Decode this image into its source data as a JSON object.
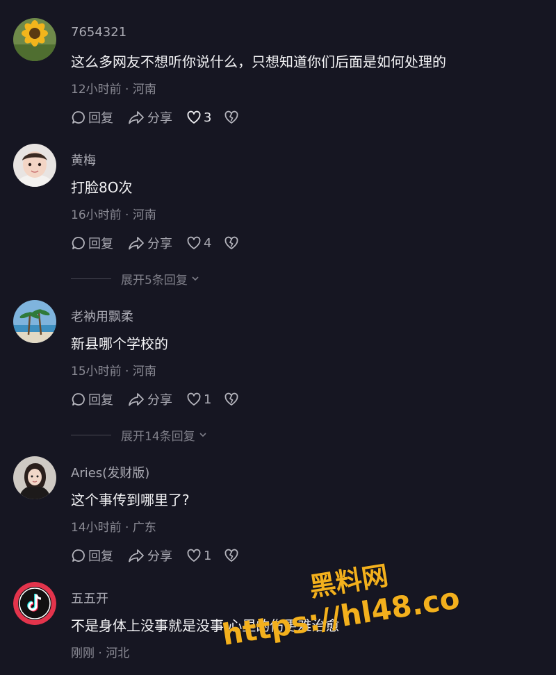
{
  "actions": {
    "reply": "回复",
    "share": "分享"
  },
  "comments": [
    {
      "username": "7654321",
      "text": "这么多网友不想听你说什么，只想知道你们后面是如何处理的",
      "meta": "12小时前 · 河南",
      "likes": "3",
      "avatar": "sunflower"
    },
    {
      "username": "黄梅",
      "text": "打脸8O次",
      "meta": "16小时前 · 河南",
      "likes": "4",
      "avatar": "baby",
      "expand": "展开5条回复"
    },
    {
      "username": "老衲用飘柔",
      "text": "新县哪个学校的",
      "meta": "15小时前 · 河南",
      "likes": "1",
      "avatar": "palm-beach",
      "expand": "展开14条回复"
    },
    {
      "username": "Aries(发财版)",
      "text": "这个事传到哪里了?",
      "meta": "14小时前 · 广东",
      "likes": "1",
      "avatar": "woman"
    },
    {
      "username": "五五开",
      "text": "不是身体上没事就是没事 心里的伤更难治愈",
      "meta": "刚刚 · 河北",
      "avatar": "tiktok-logo"
    }
  ],
  "watermark": {
    "line1": "黑料网",
    "line2": "https://hl48.co",
    "color": "#f3b01d"
  }
}
